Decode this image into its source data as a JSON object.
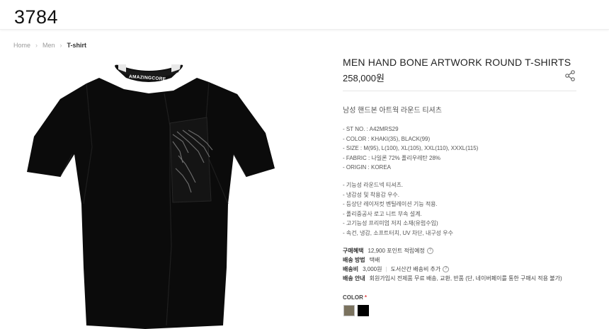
{
  "header": {
    "logo": "3784"
  },
  "breadcrumb": {
    "home": "Home",
    "category": "Men",
    "current": "T-shirt"
  },
  "product": {
    "title": "MEN HAND BONE ARTWORK ROUND T-SHIRTS",
    "price": "258,000원",
    "korean_name": "남성 핸드본 아트웍 라운드 티셔츠",
    "collar_text": "AMAZINGCORE",
    "specs": [
      "- ST NO. : A42MRS29",
      "- COLOR : KHAKI(35), BLACK(99)",
      "- SIZE : M(95), L(100), XL(105), XXL(110), XXXL(115)",
      "- FABRIC : 나일론 72% 폴리우레탄 28%",
      "- ORIGIN : KOREA"
    ],
    "features": [
      "- 기능성 라운드넥 티셔츠.",
      "- 냉감성 및 착용감 우수.",
      "- 등상단 레이저컷 벤틸레이션 기능 적용.",
      "- 폴리중공사 로고 니트 부속 설계.",
      "- 고기능성 프리미엄 저지 소재(유럽수입)",
      "- 속건, 냉감, 소프트터치, UV 차단, 내구성 우수"
    ]
  },
  "info": {
    "benefit_label": "구매혜택",
    "benefit_value": "12,900 포인트 적립예정",
    "shipping_method_label": "배송 방법",
    "shipping_method_value": "택배",
    "shipping_fee_label": "배송비",
    "shipping_fee_value": "3,000원",
    "shipping_fee_extra": "도서산간 배송비 추가",
    "shipping_guide_label": "배송 안내",
    "shipping_guide_value": "회원가입시 전제품 무료 배송, 교환, 반품 (단, 네이버페이를 통한 구매시 적용 불가)"
  },
  "color": {
    "label": "COLOR",
    "required_mark": "*",
    "options": [
      {
        "name": "KHAKI",
        "hex": "#7a725e"
      },
      {
        "name": "BLACK",
        "hex": "#000000"
      }
    ]
  }
}
